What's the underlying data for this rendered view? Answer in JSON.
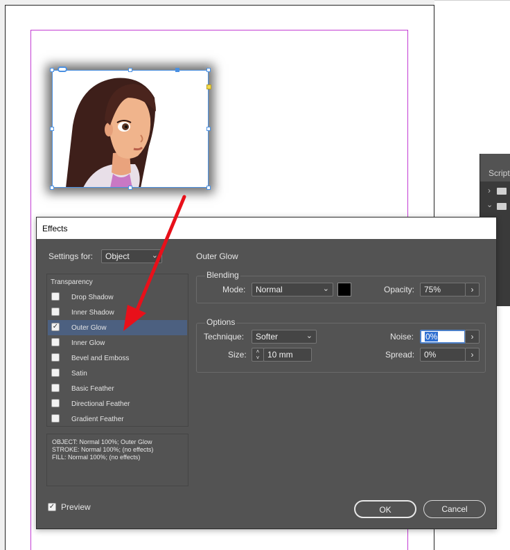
{
  "script_panel": {
    "tab_label": "Script"
  },
  "dialog": {
    "title": "Effects",
    "settings_for_label": "Settings for:",
    "settings_for_value": "Object",
    "effects_list": {
      "header": "Transparency",
      "items": [
        {
          "label": "Drop Shadow",
          "checked": false,
          "selected": false
        },
        {
          "label": "Inner Shadow",
          "checked": false,
          "selected": false
        },
        {
          "label": "Outer Glow",
          "checked": true,
          "selected": true
        },
        {
          "label": "Inner Glow",
          "checked": false,
          "selected": false
        },
        {
          "label": "Bevel and Emboss",
          "checked": false,
          "selected": false
        },
        {
          "label": "Satin",
          "checked": false,
          "selected": false
        },
        {
          "label": "Basic Feather",
          "checked": false,
          "selected": false
        },
        {
          "label": "Directional Feather",
          "checked": false,
          "selected": false
        },
        {
          "label": "Gradient Feather",
          "checked": false,
          "selected": false
        }
      ]
    },
    "summary": [
      "OBJECT: Normal 100%; Outer Glow",
      "STROKE: Normal 100%; (no effects)",
      "FILL: Normal 100%; (no effects)"
    ],
    "preview_label": "Preview",
    "preview_checked": true,
    "section_title": "Outer Glow",
    "blending": {
      "title": "Blending",
      "mode_label": "Mode:",
      "mode_value": "Normal",
      "glow_color": "#000000",
      "opacity_label": "Opacity:",
      "opacity_value": "75%"
    },
    "options": {
      "title": "Options",
      "technique_label": "Technique:",
      "technique_value": "Softer",
      "noise_label": "Noise:",
      "noise_value": "0%",
      "size_label": "Size:",
      "size_value": "10 mm",
      "spread_label": "Spread:",
      "spread_value": "0%"
    },
    "ok_label": "OK",
    "cancel_label": "Cancel"
  },
  "colors": {
    "dialog_bg": "#535353",
    "selection": "#4c6080",
    "margin_guide": "#c23bd3",
    "frame_selection": "#4a90e2",
    "annotation_arrow": "#e8101a"
  }
}
